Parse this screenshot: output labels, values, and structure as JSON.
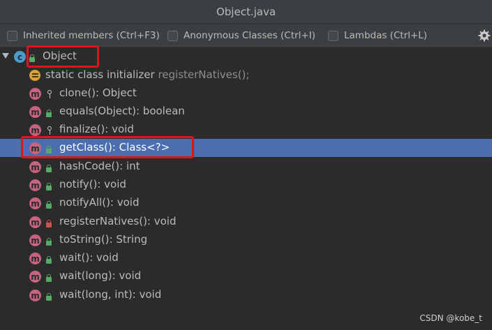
{
  "window": {
    "title": "Object.java"
  },
  "filters": [
    {
      "label": "Inherited members (Ctrl+F3)",
      "checked": false
    },
    {
      "label": "Anonymous Classes (Ctrl+I)",
      "checked": false
    },
    {
      "label": "Lambdas (Ctrl+L)",
      "checked": false
    }
  ],
  "settings_icon": "gear-icon",
  "tree": {
    "root": {
      "label": "Object",
      "icon": "class-icon",
      "visibility": "public"
    },
    "items": [
      {
        "text": "static class initializer",
        "muted": "registerNatives();",
        "icon": "static-initializer-icon",
        "visibility": "none"
      },
      {
        "text": "clone(): Object",
        "icon": "method-icon",
        "visibility": "protected"
      },
      {
        "text": "equals(Object): boolean",
        "icon": "method-icon",
        "visibility": "public"
      },
      {
        "text": "finalize(): void",
        "icon": "method-icon",
        "visibility": "protected"
      },
      {
        "text": "getClass(): Class<?>",
        "icon": "method-icon",
        "visibility": "public",
        "selected": true
      },
      {
        "text": "hashCode(): int",
        "icon": "method-icon",
        "visibility": "public"
      },
      {
        "text": "notify(): void",
        "icon": "method-icon",
        "visibility": "public"
      },
      {
        "text": "notifyAll(): void",
        "icon": "method-icon",
        "visibility": "public"
      },
      {
        "text": "registerNatives(): void",
        "icon": "method-icon",
        "visibility": "private"
      },
      {
        "text": "toString(): String",
        "icon": "method-icon",
        "visibility": "public"
      },
      {
        "text": "wait(): void",
        "icon": "method-icon",
        "visibility": "public"
      },
      {
        "text": "wait(long): void",
        "icon": "method-icon",
        "visibility": "public"
      },
      {
        "text": "wait(long, int): void",
        "icon": "method-icon",
        "visibility": "public"
      }
    ]
  },
  "colors": {
    "background": "#2b2b2b",
    "selection": "#4b6eaf",
    "highlight_box": "#e0141b",
    "method_icon": "#c7627f",
    "class_icon": "#4a9bc8",
    "public": "#59a869",
    "private": "#c75450"
  },
  "watermark": "CSDN @kobe_t"
}
